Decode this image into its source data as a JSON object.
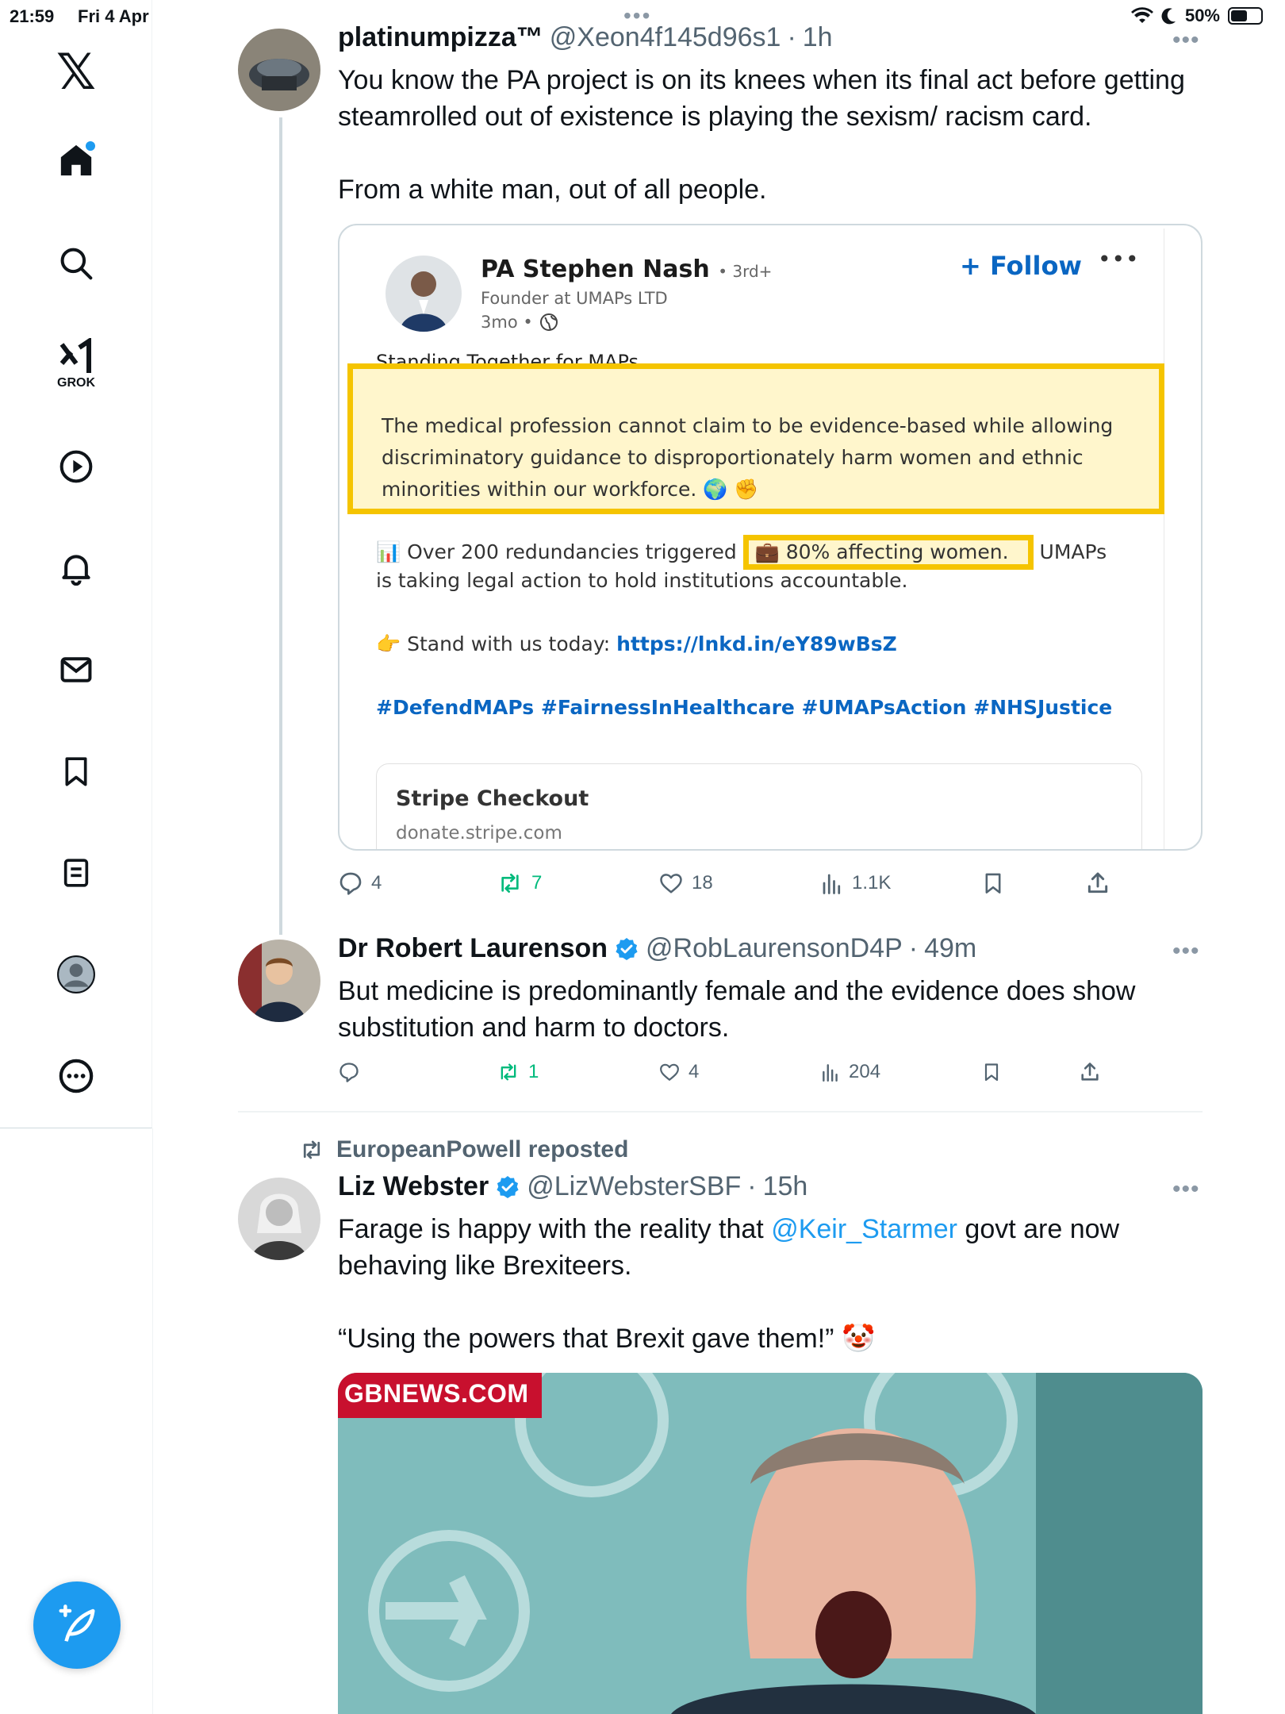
{
  "status_bar": {
    "time": "21:59",
    "date": "Fri 4 Apr",
    "battery": "50%"
  },
  "sidebar": {
    "items": [
      {
        "name": "home",
        "label": "Home"
      },
      {
        "name": "explore",
        "label": "Explore"
      },
      {
        "name": "grok",
        "label": "GROK"
      },
      {
        "name": "video",
        "label": "Video"
      },
      {
        "name": "notifications",
        "label": "Notifications"
      },
      {
        "name": "messages",
        "label": "Messages"
      },
      {
        "name": "bookmarks",
        "label": "Bookmarks"
      },
      {
        "name": "lists",
        "label": "Lists"
      },
      {
        "name": "profile",
        "label": "Profile"
      },
      {
        "name": "more",
        "label": "More"
      }
    ],
    "grok_label": "GROK"
  },
  "tweets": [
    {
      "display_name": "platinumpizza™",
      "handle": "@Xeon4f145d96s1",
      "time": "1h",
      "text_line1": "You know the PA project is on its knees when its final act before getting",
      "text_line2": "steamrolled out of existence is playing the sexism/ racism card.",
      "text_line3": "From a white man, out of all people.",
      "embed": {
        "name": "PA Stephen Nash",
        "degree": "• 3rd+",
        "title": "Founder at UMAPs LTD",
        "time": "3mo •",
        "follow_label": "+ Follow",
        "cut_text": "Standing Together for MAPs",
        "highlight_text": "The medical profession cannot claim to be evidence-based while allowing discriminatory guidance to disproportionately harm women and ethnic minorities within our workforce. 🌍 ✊",
        "body_pre": "📊 Over 200 redundancies triggered",
        "body_box": "💼 80% affecting women.",
        "body_post": "UMAPs",
        "body_line2": "is taking legal action to hold institutions accountable.",
        "stand_text": "👉 Stand with us today:",
        "stand_link": "https://lnkd.in/eY89wBsZ",
        "hashtags": "#DefendMAPs #FairnessInHealthcare #UMAPsAction #NHSJustice",
        "stripe_title": "Stripe Checkout",
        "stripe_domain": "donate.stripe.com"
      },
      "stats": {
        "replies": "4",
        "reposts": "7",
        "likes": "18",
        "views": "1.1K"
      }
    },
    {
      "display_name": "Dr Robert Laurenson",
      "handle": "@RobLaurensonD4P",
      "time": "49m",
      "text_line1": "But medicine is predominantly female and the evidence does show",
      "text_line2": "substitution and harm to doctors.",
      "stats": {
        "replies": "",
        "reposts": "1",
        "likes": "4",
        "views": "204"
      }
    },
    {
      "reposted_by": "EuropeanPowell reposted",
      "display_name": "Liz Webster",
      "handle": "@LizWebsterSBF",
      "time": "15h",
      "text_pre": "Farage is happy with the reality that ",
      "mention": "@Keir_Starmer",
      "text_post": " govt are now",
      "text_line2": "behaving like Brexiteers.",
      "text_line3": "“Using the powers that Brexit gave them!” 🤡",
      "media_tag": "GBNEWS.COM"
    }
  ],
  "colors": {
    "accent": "#1d9bf0",
    "repost_green": "#00ba7c",
    "linkedin_blue": "#0a66c2",
    "highlight_yellow": "#f5c400"
  }
}
